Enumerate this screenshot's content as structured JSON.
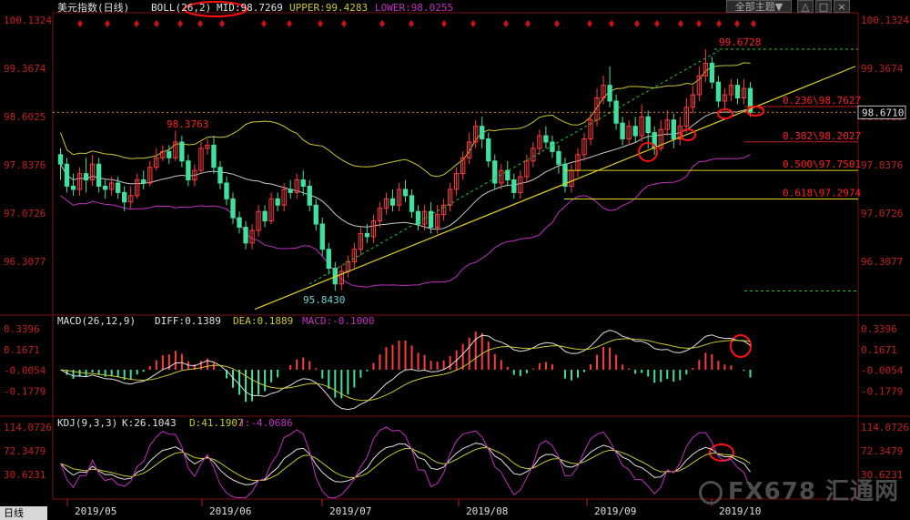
{
  "window": {
    "theme_button": "全部主题▼",
    "buttons": [
      "△",
      "□",
      "×"
    ],
    "bottom_tab": "日线",
    "watermark": "FX678 汇通网"
  },
  "colors": {
    "up": "#ff3c3c",
    "down": "#40e0a0",
    "mid": "#c8c8c8",
    "upper": "#c8c830",
    "lower": "#c030c0",
    "fib": "#e0d020",
    "axis": "#c02020",
    "annot": "#ff2020"
  },
  "chart_data": {
    "type": "candlestick",
    "symbol_header": "美元指数(日线)",
    "dates_axis": [
      "2019/05",
      "2019/06",
      "2019/07",
      "2019/08",
      "2019/09",
      "2019/10"
    ],
    "main": {
      "indicator": "BOLL(26,2)",
      "values": {
        "MID": "98.7269",
        "UPPER": "99.4283",
        "LOWER": "98.0255"
      },
      "y_ticks": [
        "100.1324",
        "99.3674",
        "98.6025",
        "97.8376",
        "97.0726",
        "96.3077"
      ],
      "ylim": [
        95.5,
        100.25
      ],
      "current_price": "98.6710",
      "annotations": [
        "99.6728",
        "98.3763",
        "95.8430"
      ],
      "fib_levels": [
        {
          "label": "0.236\\98.7627",
          "value": 98.7627
        },
        {
          "label": "0.382\\98.2027",
          "value": 98.2027
        },
        {
          "label": "0.500\\97.7501",
          "value": 97.7501
        },
        {
          "label": "0.618\\97.2974",
          "value": 97.2974
        }
      ],
      "candles": [
        {
          "o": 98.0,
          "c": 97.85,
          "h": 98.1,
          "l": 97.6
        },
        {
          "o": 97.85,
          "c": 97.5,
          "h": 97.95,
          "l": 97.4
        },
        {
          "o": 97.5,
          "c": 97.45,
          "h": 97.7,
          "l": 97.35
        },
        {
          "o": 97.45,
          "c": 97.7,
          "h": 97.8,
          "l": 97.35
        },
        {
          "o": 97.7,
          "c": 97.6,
          "h": 97.95,
          "l": 97.4
        },
        {
          "o": 97.6,
          "c": 97.85,
          "h": 98.0,
          "l": 97.5
        },
        {
          "o": 97.85,
          "c": 97.5,
          "h": 97.95,
          "l": 97.4
        },
        {
          "o": 97.5,
          "c": 97.45,
          "h": 97.6,
          "l": 97.3
        },
        {
          "o": 97.45,
          "c": 97.55,
          "h": 97.65,
          "l": 97.35
        },
        {
          "o": 97.55,
          "c": 97.4,
          "h": 97.65,
          "l": 97.3
        },
        {
          "o": 97.4,
          "c": 97.25,
          "h": 97.5,
          "l": 97.1
        },
        {
          "o": 97.25,
          "c": 97.35,
          "h": 97.5,
          "l": 97.15
        },
        {
          "o": 97.35,
          "c": 97.6,
          "h": 97.7,
          "l": 97.3
        },
        {
          "o": 97.6,
          "c": 97.55,
          "h": 97.75,
          "l": 97.45
        },
        {
          "o": 97.55,
          "c": 97.8,
          "h": 97.9,
          "l": 97.5
        },
        {
          "o": 97.8,
          "c": 97.95,
          "h": 98.1,
          "l": 97.75
        },
        {
          "o": 97.95,
          "c": 98.05,
          "h": 98.15,
          "l": 97.9
        },
        {
          "o": 98.05,
          "c": 97.95,
          "h": 98.15,
          "l": 97.85
        },
        {
          "o": 97.95,
          "c": 98.2,
          "h": 98.38,
          "l": 97.9
        },
        {
          "o": 98.2,
          "c": 97.9,
          "h": 98.3,
          "l": 97.8
        },
        {
          "o": 97.9,
          "c": 97.6,
          "h": 98.0,
          "l": 97.5
        },
        {
          "o": 97.6,
          "c": 97.75,
          "h": 97.85,
          "l": 97.5
        },
        {
          "o": 97.75,
          "c": 98.1,
          "h": 98.2,
          "l": 97.7
        },
        {
          "o": 98.1,
          "c": 98.15,
          "h": 98.25,
          "l": 98.0
        },
        {
          "o": 98.15,
          "c": 97.8,
          "h": 98.3,
          "l": 97.7
        },
        {
          "o": 97.8,
          "c": 97.55,
          "h": 97.9,
          "l": 97.45
        },
        {
          "o": 97.55,
          "c": 97.3,
          "h": 97.65,
          "l": 97.2
        },
        {
          "o": 97.3,
          "c": 97.0,
          "h": 97.4,
          "l": 96.9
        },
        {
          "o": 97.0,
          "c": 96.85,
          "h": 97.1,
          "l": 96.75
        },
        {
          "o": 96.85,
          "c": 96.6,
          "h": 96.95,
          "l": 96.5
        },
        {
          "o": 96.6,
          "c": 96.8,
          "h": 96.9,
          "l": 96.5
        },
        {
          "o": 96.8,
          "c": 97.1,
          "h": 97.2,
          "l": 96.7
        },
        {
          "o": 97.1,
          "c": 96.95,
          "h": 97.2,
          "l": 96.85
        },
        {
          "o": 96.95,
          "c": 97.3,
          "h": 97.4,
          "l": 96.9
        },
        {
          "o": 97.3,
          "c": 97.2,
          "h": 97.4,
          "l": 97.1
        },
        {
          "o": 97.2,
          "c": 97.45,
          "h": 97.55,
          "l": 97.1
        },
        {
          "o": 97.45,
          "c": 97.4,
          "h": 97.6,
          "l": 97.3
        },
        {
          "o": 97.4,
          "c": 97.6,
          "h": 97.7,
          "l": 97.3
        },
        {
          "o": 97.6,
          "c": 97.5,
          "h": 97.75,
          "l": 97.35
        },
        {
          "o": 97.5,
          "c": 97.2,
          "h": 97.6,
          "l": 97.1
        },
        {
          "o": 97.2,
          "c": 96.9,
          "h": 97.3,
          "l": 96.8
        },
        {
          "o": 96.9,
          "c": 96.5,
          "h": 97.0,
          "l": 96.4
        },
        {
          "o": 96.5,
          "c": 96.2,
          "h": 96.6,
          "l": 96.1
        },
        {
          "o": 96.2,
          "c": 95.95,
          "h": 96.3,
          "l": 95.84
        },
        {
          "o": 95.95,
          "c": 96.15,
          "h": 96.25,
          "l": 95.85
        },
        {
          "o": 96.15,
          "c": 96.3,
          "h": 96.4,
          "l": 96.05
        },
        {
          "o": 96.3,
          "c": 96.5,
          "h": 96.6,
          "l": 96.2
        },
        {
          "o": 96.5,
          "c": 96.75,
          "h": 96.85,
          "l": 96.4
        },
        {
          "o": 96.75,
          "c": 96.7,
          "h": 96.9,
          "l": 96.6
        },
        {
          "o": 96.7,
          "c": 96.95,
          "h": 97.05,
          "l": 96.6
        },
        {
          "o": 96.95,
          "c": 97.15,
          "h": 97.25,
          "l": 96.85
        },
        {
          "o": 97.15,
          "c": 97.3,
          "h": 97.4,
          "l": 97.05
        },
        {
          "o": 97.3,
          "c": 97.2,
          "h": 97.45,
          "l": 97.1
        },
        {
          "o": 97.2,
          "c": 97.45,
          "h": 97.55,
          "l": 97.1
        },
        {
          "o": 97.45,
          "c": 97.35,
          "h": 97.6,
          "l": 97.25
        },
        {
          "o": 97.35,
          "c": 97.1,
          "h": 97.45,
          "l": 97.0
        },
        {
          "o": 97.1,
          "c": 96.9,
          "h": 97.2,
          "l": 96.8
        },
        {
          "o": 96.9,
          "c": 97.1,
          "h": 97.2,
          "l": 96.8
        },
        {
          "o": 97.1,
          "c": 96.85,
          "h": 97.25,
          "l": 96.75
        },
        {
          "o": 96.85,
          "c": 97.05,
          "h": 97.2,
          "l": 96.75
        },
        {
          "o": 97.05,
          "c": 97.2,
          "h": 97.3,
          "l": 96.95
        },
        {
          "o": 97.2,
          "c": 97.45,
          "h": 97.55,
          "l": 97.1
        },
        {
          "o": 97.45,
          "c": 97.7,
          "h": 97.8,
          "l": 97.35
        },
        {
          "o": 97.7,
          "c": 97.95,
          "h": 98.05,
          "l": 97.6
        },
        {
          "o": 97.95,
          "c": 98.2,
          "h": 98.35,
          "l": 97.85
        },
        {
          "o": 98.2,
          "c": 98.45,
          "h": 98.55,
          "l": 98.1
        },
        {
          "o": 98.45,
          "c": 98.25,
          "h": 98.6,
          "l": 98.1
        },
        {
          "o": 98.25,
          "c": 97.9,
          "h": 98.35,
          "l": 97.8
        },
        {
          "o": 97.9,
          "c": 97.55,
          "h": 98.0,
          "l": 97.45
        },
        {
          "o": 97.55,
          "c": 97.75,
          "h": 97.85,
          "l": 97.45
        },
        {
          "o": 97.75,
          "c": 97.6,
          "h": 97.9,
          "l": 97.5
        },
        {
          "o": 97.6,
          "c": 97.4,
          "h": 97.7,
          "l": 97.3
        },
        {
          "o": 97.4,
          "c": 97.65,
          "h": 97.75,
          "l": 97.3
        },
        {
          "o": 97.65,
          "c": 97.9,
          "h": 98.0,
          "l": 97.55
        },
        {
          "o": 97.9,
          "c": 98.1,
          "h": 98.2,
          "l": 97.8
        },
        {
          "o": 98.1,
          "c": 98.3,
          "h": 98.4,
          "l": 98.0
        },
        {
          "o": 98.3,
          "c": 98.2,
          "h": 98.45,
          "l": 98.1
        },
        {
          "o": 98.2,
          "c": 98.05,
          "h": 98.3,
          "l": 97.95
        },
        {
          "o": 98.05,
          "c": 97.85,
          "h": 98.15,
          "l": 97.7
        },
        {
          "o": 97.85,
          "c": 97.5,
          "h": 97.95,
          "l": 97.4
        },
        {
          "o": 97.5,
          "c": 97.75,
          "h": 97.85,
          "l": 97.4
        },
        {
          "o": 97.75,
          "c": 98.0,
          "h": 98.1,
          "l": 97.65
        },
        {
          "o": 98.0,
          "c": 98.25,
          "h": 98.35,
          "l": 97.9
        },
        {
          "o": 98.25,
          "c": 98.55,
          "h": 98.65,
          "l": 98.15
        },
        {
          "o": 98.55,
          "c": 98.9,
          "h": 99.05,
          "l": 98.45
        },
        {
          "o": 98.9,
          "c": 99.1,
          "h": 99.25,
          "l": 98.8
        },
        {
          "o": 99.1,
          "c": 98.85,
          "h": 99.4,
          "l": 98.75
        },
        {
          "o": 98.85,
          "c": 98.5,
          "h": 98.95,
          "l": 98.4
        },
        {
          "o": 98.5,
          "c": 98.25,
          "h": 98.6,
          "l": 98.15
        },
        {
          "o": 98.25,
          "c": 98.45,
          "h": 98.55,
          "l": 98.15
        },
        {
          "o": 98.45,
          "c": 98.3,
          "h": 98.6,
          "l": 98.2
        },
        {
          "o": 98.3,
          "c": 98.6,
          "h": 98.8,
          "l": 98.2
        },
        {
          "o": 98.6,
          "c": 98.35,
          "h": 98.7,
          "l": 98.1
        },
        {
          "o": 98.35,
          "c": 98.1,
          "h": 98.45,
          "l": 98.0
        },
        {
          "o": 98.1,
          "c": 98.4,
          "h": 98.55,
          "l": 98.05
        },
        {
          "o": 98.4,
          "c": 98.55,
          "h": 98.7,
          "l": 98.3
        },
        {
          "o": 98.55,
          "c": 98.25,
          "h": 98.65,
          "l": 98.1
        },
        {
          "o": 98.25,
          "c": 98.45,
          "h": 98.6,
          "l": 98.15
        },
        {
          "o": 98.45,
          "c": 98.75,
          "h": 98.9,
          "l": 98.35
        },
        {
          "o": 98.75,
          "c": 98.95,
          "h": 99.1,
          "l": 98.65
        },
        {
          "o": 98.95,
          "c": 99.25,
          "h": 99.4,
          "l": 98.85
        },
        {
          "o": 99.25,
          "c": 99.45,
          "h": 99.67,
          "l": 99.15
        },
        {
          "o": 99.45,
          "c": 99.15,
          "h": 99.55,
          "l": 99.05
        },
        {
          "o": 99.15,
          "c": 98.85,
          "h": 99.25,
          "l": 98.75
        },
        {
          "o": 98.85,
          "c": 98.95,
          "h": 99.05,
          "l": 98.7
        },
        {
          "o": 98.95,
          "c": 99.1,
          "h": 99.2,
          "l": 98.85
        },
        {
          "o": 99.1,
          "c": 98.9,
          "h": 99.2,
          "l": 98.8
        },
        {
          "o": 98.9,
          "c": 99.05,
          "h": 99.2,
          "l": 98.8
        },
        {
          "o": 99.05,
          "c": 98.67,
          "h": 99.15,
          "l": 98.6
        }
      ]
    },
    "macd": {
      "header": "MACD(26,12,9)",
      "values": {
        "DIFF": "0.1389",
        "DEA": "0.1889",
        "MACD": "-0.1000"
      },
      "y_ticks": [
        "0.3396",
        "0.1671",
        "-0.0054",
        "-0.1779"
      ],
      "ylim": [
        -0.37,
        0.43
      ]
    },
    "kdj": {
      "header": "KDJ(9,3,3)",
      "values": {
        "K": "26.1043",
        "D": "41.1907",
        "J": "-4.0686"
      },
      "y_ticks": [
        "114.0726",
        "72.3479",
        "30.6231"
      ],
      "ylim": [
        -12,
        128
      ]
    }
  }
}
